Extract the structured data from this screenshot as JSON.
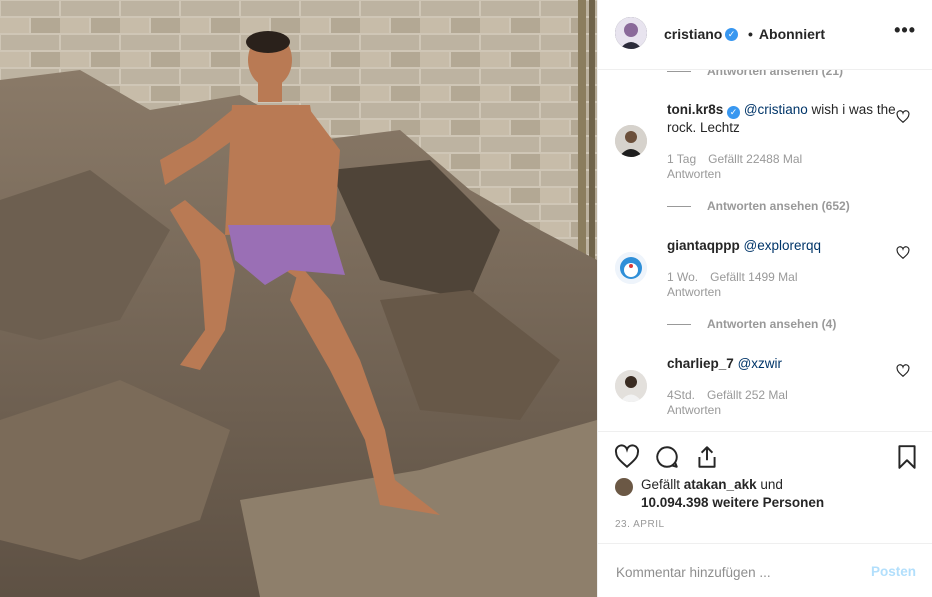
{
  "post": {
    "author": "cristiano",
    "follow_status": "Abonniert",
    "more_icon": "more-horizontal-icon"
  },
  "comments": [
    {
      "replies_label": "Antworten ansehen (21)"
    },
    {
      "username": "toni.kr8s",
      "mention": "@cristiano",
      "text": " wish i was the rock. Lechtz",
      "time": "1 Tag",
      "likes": "Gefällt 22488 Mal",
      "reply": "Antworten",
      "replies_label": "Antworten ansehen (652)"
    },
    {
      "username": "giantaqppp",
      "mention": "@explorerqq",
      "text": "",
      "time": "1 Wo.",
      "likes": "Gefällt 1499 Mal",
      "reply": "Antworten",
      "replies_label": "Antworten ansehen (4)"
    },
    {
      "username": "charliep_7",
      "mention": "@xzwir",
      "text": "",
      "time": "4Std.",
      "likes": "Gefällt 252 Mal",
      "reply": "Antworten"
    }
  ],
  "likes": {
    "prefix": "Gefällt ",
    "user": "atakan_akk",
    "and": " und",
    "others": "10.094.398 weitere Personen"
  },
  "date": "23. APRIL",
  "add_comment": {
    "placeholder": "Kommentar hinzufügen ...",
    "post_label": "Posten"
  },
  "colors": {
    "verified": "#3897f0",
    "mention": "#003569",
    "muted": "#999999",
    "post_disabled": "#b2dffc"
  }
}
